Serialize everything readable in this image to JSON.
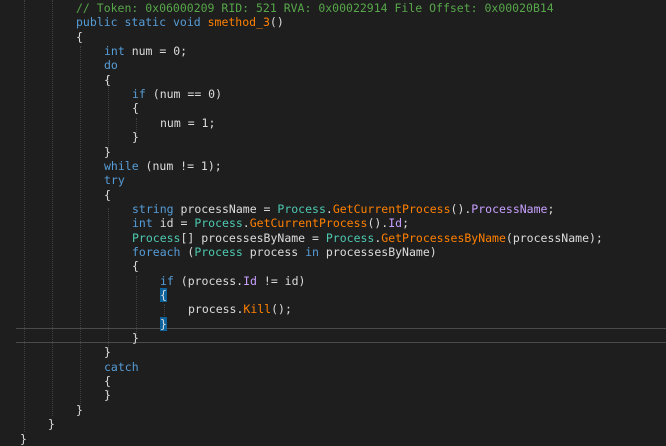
{
  "editor": {
    "highlighted_line": 24,
    "lines": [
      {
        "indent": 76,
        "tokens": [
          {
            "t": "// Token: 0x06000209 RID: 521 RVA: 0x00022914 File Offset: 0x00020B14",
            "c": "comment"
          }
        ]
      },
      {
        "indent": 76,
        "tokens": [
          {
            "t": "public",
            "c": "keyword"
          },
          {
            "t": " "
          },
          {
            "t": "static",
            "c": "keyword"
          },
          {
            "t": " "
          },
          {
            "t": "void",
            "c": "keyword"
          },
          {
            "t": " "
          },
          {
            "t": "smethod_3",
            "c": "method"
          },
          {
            "t": "()"
          }
        ]
      },
      {
        "indent": 76,
        "tokens": [
          {
            "t": "{"
          }
        ]
      },
      {
        "indent": 104,
        "tokens": [
          {
            "t": "int",
            "c": "keyword"
          },
          {
            "t": " num = 0;"
          }
        ]
      },
      {
        "indent": 104,
        "tokens": [
          {
            "t": "do",
            "c": "keyword"
          }
        ]
      },
      {
        "indent": 104,
        "tokens": [
          {
            "t": "{"
          }
        ]
      },
      {
        "indent": 132,
        "tokens": [
          {
            "t": "if",
            "c": "keyword"
          },
          {
            "t": " (num == 0)"
          }
        ]
      },
      {
        "indent": 132,
        "tokens": [
          {
            "t": "{"
          }
        ]
      },
      {
        "indent": 160,
        "tokens": [
          {
            "t": "num = 1;"
          }
        ]
      },
      {
        "indent": 132,
        "tokens": [
          {
            "t": "}"
          }
        ]
      },
      {
        "indent": 104,
        "tokens": [
          {
            "t": "}"
          }
        ]
      },
      {
        "indent": 104,
        "tokens": [
          {
            "t": "while",
            "c": "keyword"
          },
          {
            "t": " (num != 1);"
          }
        ]
      },
      {
        "indent": 104,
        "tokens": [
          {
            "t": "try",
            "c": "keyword"
          }
        ]
      },
      {
        "indent": 104,
        "tokens": [
          {
            "t": "{"
          }
        ]
      },
      {
        "indent": 132,
        "tokens": [
          {
            "t": "string",
            "c": "keyword"
          },
          {
            "t": " processName = "
          },
          {
            "t": "Process",
            "c": "type"
          },
          {
            "t": "."
          },
          {
            "t": "GetCurrentProcess",
            "c": "method"
          },
          {
            "t": "()."
          },
          {
            "t": "ProcessName",
            "c": "prop"
          },
          {
            "t": ";"
          }
        ]
      },
      {
        "indent": 132,
        "tokens": [
          {
            "t": "int",
            "c": "keyword"
          },
          {
            "t": " id = "
          },
          {
            "t": "Process",
            "c": "type"
          },
          {
            "t": "."
          },
          {
            "t": "GetCurrentProcess",
            "c": "method"
          },
          {
            "t": "()."
          },
          {
            "t": "Id",
            "c": "prop"
          },
          {
            "t": ";"
          }
        ]
      },
      {
        "indent": 132,
        "tokens": [
          {
            "t": "Process",
            "c": "type"
          },
          {
            "t": "[] processesByName = "
          },
          {
            "t": "Process",
            "c": "type"
          },
          {
            "t": "."
          },
          {
            "t": "GetProcessesByName",
            "c": "method"
          },
          {
            "t": "(processName);"
          }
        ]
      },
      {
        "indent": 132,
        "tokens": [
          {
            "t": "foreach",
            "c": "keyword"
          },
          {
            "t": " ("
          },
          {
            "t": "Process",
            "c": "type"
          },
          {
            "t": " process "
          },
          {
            "t": "in",
            "c": "keyword"
          },
          {
            "t": " processesByName)"
          }
        ]
      },
      {
        "indent": 132,
        "tokens": [
          {
            "t": "{"
          }
        ]
      },
      {
        "indent": 160,
        "tokens": [
          {
            "t": "if",
            "c": "keyword"
          },
          {
            "t": " (process."
          },
          {
            "t": "Id",
            "c": "prop"
          },
          {
            "t": " != id)"
          }
        ]
      },
      {
        "indent": 160,
        "tokens": [
          {
            "t": "{",
            "c": "brace-hl"
          }
        ]
      },
      {
        "indent": 188,
        "tokens": [
          {
            "t": "process."
          },
          {
            "t": "Kill",
            "c": "method"
          },
          {
            "t": "();"
          }
        ]
      },
      {
        "indent": 160,
        "tokens": [
          {
            "t": "}",
            "c": "brace-hl"
          }
        ]
      },
      {
        "indent": 132,
        "tokens": [
          {
            "t": "}"
          }
        ]
      },
      {
        "indent": 104,
        "tokens": [
          {
            "t": "}"
          }
        ]
      },
      {
        "indent": 104,
        "tokens": [
          {
            "t": "catch",
            "c": "keyword"
          }
        ]
      },
      {
        "indent": 104,
        "tokens": [
          {
            "t": "{"
          }
        ]
      },
      {
        "indent": 104,
        "tokens": [
          {
            "t": "}"
          }
        ]
      },
      {
        "indent": 76,
        "tokens": [
          {
            "t": "}"
          }
        ]
      },
      {
        "indent": 48,
        "tokens": [
          {
            "t": "}"
          }
        ]
      },
      {
        "indent": 20,
        "tokens": [
          {
            "t": "}"
          }
        ]
      }
    ]
  }
}
